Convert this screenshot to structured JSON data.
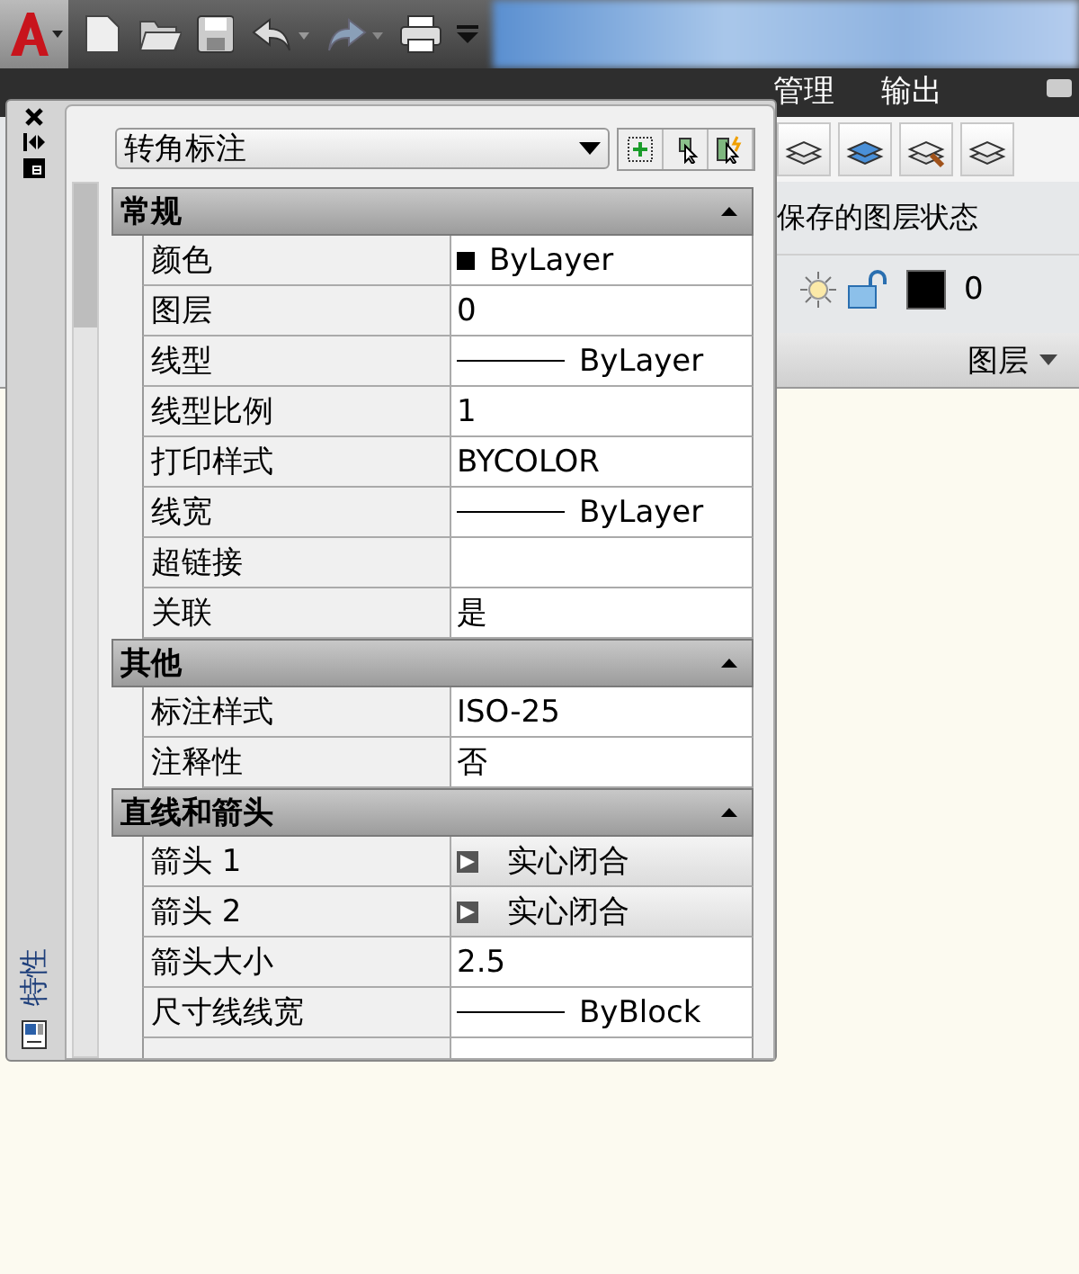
{
  "ribbon": {
    "tabs": [
      {
        "label": "管理",
        "selected": false
      },
      {
        "label": "输出",
        "selected": false
      }
    ],
    "panel": {
      "state_label": "保存的图层状态",
      "layer_name": "0",
      "title": "图层"
    }
  },
  "palette": {
    "title": "特性",
    "object_type": "转角标注",
    "sections": [
      {
        "title": "常规",
        "expanded": true,
        "rows": [
          {
            "label": "颜色",
            "value": "ByLayer",
            "kind": "color"
          },
          {
            "label": "图层",
            "value": "0",
            "kind": "text"
          },
          {
            "label": "线型",
            "value": "ByLayer",
            "kind": "line"
          },
          {
            "label": "线型比例",
            "value": "1",
            "kind": "text"
          },
          {
            "label": "打印样式",
            "value": "BYCOLOR",
            "kind": "text"
          },
          {
            "label": "线宽",
            "value": "ByLayer",
            "kind": "line"
          },
          {
            "label": "超链接",
            "kind": "text"
          },
          {
            "label": "关联",
            "value": "是",
            "kind": "text"
          }
        ]
      },
      {
        "title": "其他",
        "expanded": true,
        "rows": [
          {
            "label": "标注样式",
            "value": "ISO-25",
            "kind": "text"
          },
          {
            "label": "注释性",
            "value": "否",
            "kind": "text"
          }
        ]
      },
      {
        "title": "直线和箭头",
        "expanded": true,
        "rows": [
          {
            "label": "箭头 1",
            "value": "实心闭合",
            "kind": "arrow"
          },
          {
            "label": "箭头 2",
            "value": "实心闭合",
            "kind": "arrow"
          },
          {
            "label": "箭头大小",
            "value": "2.5",
            "kind": "text"
          },
          {
            "label": "尺寸线线宽",
            "value": "ByBlock",
            "kind": "line"
          }
        ]
      }
    ]
  }
}
